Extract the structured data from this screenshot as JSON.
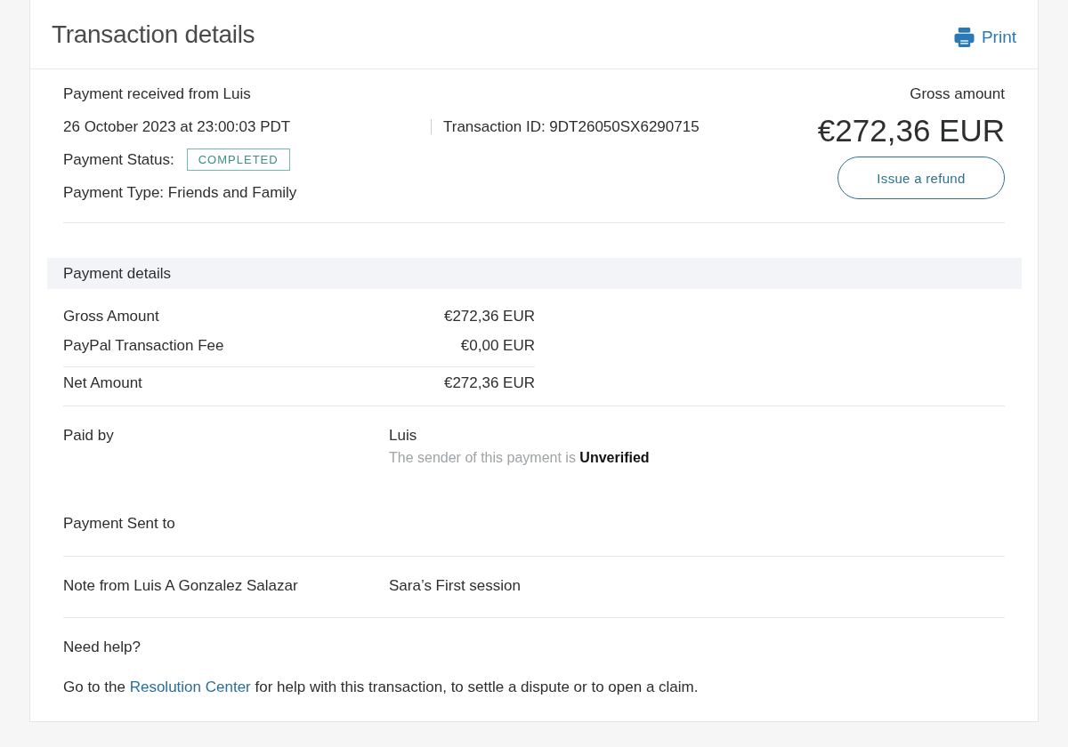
{
  "header": {
    "title": "Transaction details",
    "print_link": "Print"
  },
  "summary": {
    "received_from": "Payment received from Luis",
    "date": "26 October 2023 at 23:00:03 PDT",
    "transaction_id": "Transaction ID: 9DT26050SX6290715",
    "status_label": "Payment Status:",
    "status": "COMPLETED",
    "payment_type": "Payment Type: Friends and Family",
    "gross_label": "Gross amount",
    "gross_amount": "€272,36 EUR",
    "refund_button": "Issue a refund"
  },
  "payment_details": {
    "heading": "Payment details",
    "lines": [
      {
        "label": "Gross Amount",
        "value": "€272,36 EUR"
      },
      {
        "label": "PayPal Transaction Fee",
        "value": "€0,00 EUR"
      }
    ],
    "net": {
      "label": "Net Amount",
      "value": "€272,36 EUR"
    }
  },
  "people": [
    {
      "label": "Paid by",
      "lines": [
        {
          "kind": "name",
          "text": "Luis"
        },
        {
          "kind": "note",
          "text": "The sender of this payment is **Unverified**"
        }
      ]
    },
    {
      "label": "Payment Sent to"
    }
  ],
  "note": {
    "label": "Note from Luis A Gonzalez Salazar",
    "text": "Sara’s First session"
  },
  "help": {
    "heading": "Need help?",
    "text_before": "Go to the",
    "link": "Resolution Center",
    "text_after": "for help with this transaction, to settle a dispute or to open a claim."
  }
}
